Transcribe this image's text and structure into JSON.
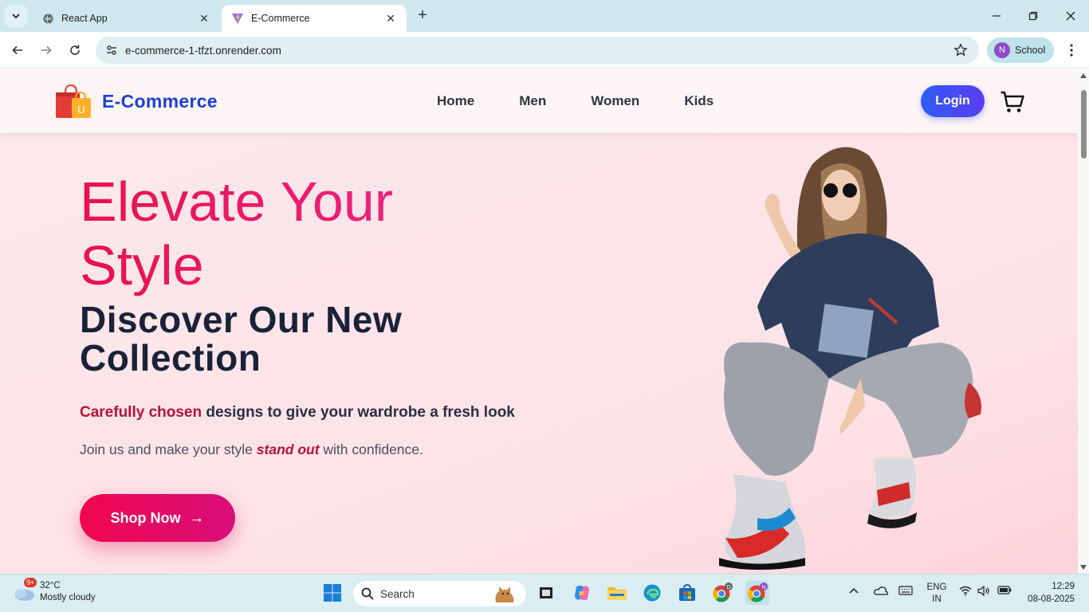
{
  "browser": {
    "tabs": [
      {
        "title": "React App",
        "active": false,
        "icon": "globe-icon"
      },
      {
        "title": "E-Commerce",
        "active": true,
        "icon": "vite-icon"
      }
    ],
    "url": "e-commerce-1-tfzt.onrender.com",
    "profile": {
      "initial": "N",
      "name": "School"
    }
  },
  "site": {
    "brand": "E-Commerce",
    "brand_logo_letter": "U",
    "menu": [
      "Home",
      "Men",
      "Women",
      "Kids"
    ],
    "login_label": "Login",
    "hero": {
      "title": "Elevate Your Style",
      "subtitle": "Discover Our New Collection",
      "tagline_highlight": "Carefully chosen",
      "tagline_rest": " designs to give your wardrobe a fresh look",
      "desc_before": "Join us and make your style ",
      "desc_emphasis": "stand out",
      "desc_after": " with confidence.",
      "cta_label": "Shop Now",
      "cta_arrow": "→"
    },
    "colors": {
      "brand": "#1d3fcf",
      "accent": "#e8104f",
      "login": "#3b4ff2"
    }
  },
  "taskbar": {
    "weather": {
      "temp": "32°C",
      "condition": "Mostly cloudy",
      "badge": "9+"
    },
    "search_placeholder": "Search",
    "lang": {
      "line1": "ENG",
      "line2": "IN"
    },
    "time": "12:29",
    "date": "08-08-2025",
    "chrome_profile_badge_1": "D",
    "chrome_profile_badge_2": "N"
  }
}
